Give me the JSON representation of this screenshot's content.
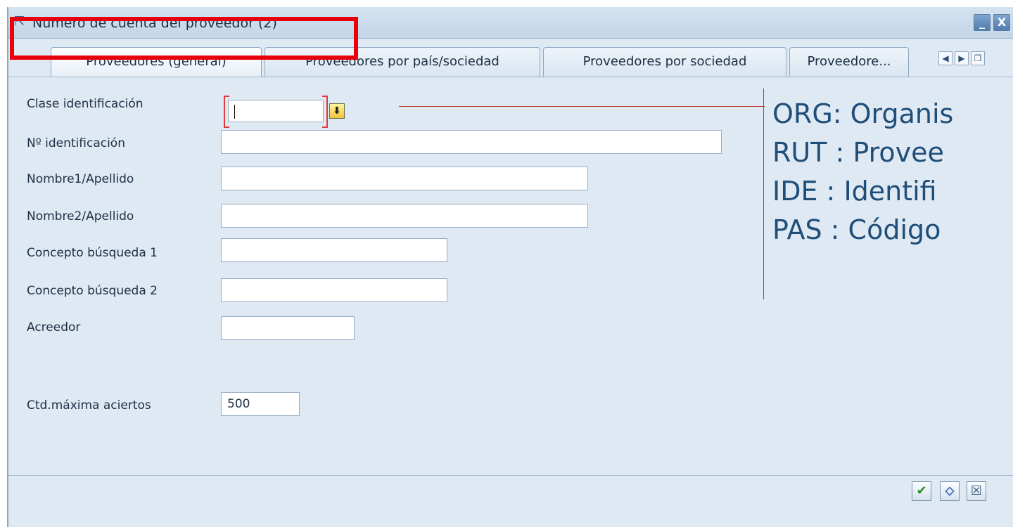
{
  "window": {
    "title": "Número de cuenta del proveedor (2)",
    "controls": {
      "minimize": "_",
      "close": "X"
    }
  },
  "tabs": [
    {
      "label": "Proveedores (general)"
    },
    {
      "label": "Proveedores por país/sociedad"
    },
    {
      "label": "Proveedores por sociedad"
    },
    {
      "label": "Proveedore..."
    }
  ],
  "tab_nav": {
    "prev": "◀",
    "next": "▶",
    "list": "❐"
  },
  "fields": {
    "clase_identificacion": {
      "label": "Clase identificación",
      "value": ""
    },
    "no_identificacion": {
      "label": "Nº identificación",
      "value": ""
    },
    "nombre1": {
      "label": "Nombre1/Apellido",
      "value": ""
    },
    "nombre2": {
      "label": "Nombre2/Apellido",
      "value": ""
    },
    "concepto1": {
      "label": "Concepto búsqueda 1",
      "value": ""
    },
    "concepto2": {
      "label": "Concepto búsqueda 2",
      "value": ""
    },
    "acreedor": {
      "label": "Acreedor",
      "value": ""
    },
    "max_aciertos": {
      "label": "Ctd.máxima aciertos",
      "value": "500"
    }
  },
  "annotation": {
    "lines": [
      "ORG: Organis",
      "RUT : Provee",
      "IDE  : Identifi",
      "PAS  : Código"
    ],
    "color": "#1f4e79"
  },
  "highlight_color": "#e8000b",
  "buttons": {
    "confirm": "✔",
    "multi_select": "⬦",
    "cancel": "☒"
  }
}
